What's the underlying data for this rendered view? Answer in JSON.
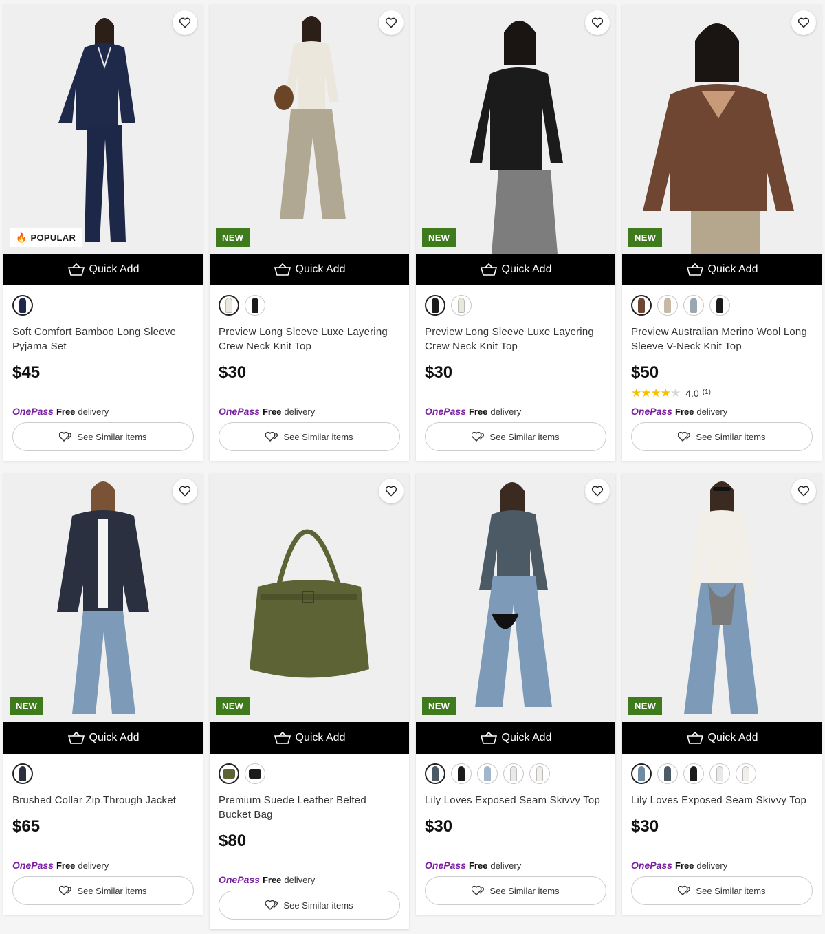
{
  "common": {
    "quick_add": "Quick Add",
    "see_similar": "See Similar items",
    "onepass_logo": "OnePass",
    "free": "Free",
    "delivery": "delivery",
    "badge_new": "NEW",
    "badge_popular": "POPULAR"
  },
  "products": [
    {
      "title": "Soft Comfort Bamboo Long Sleeve Pyjama Set",
      "price": "$45",
      "badge": "POPULAR",
      "swatches": [
        "#1f2a4a"
      ],
      "image": "navy-pyjama-set"
    },
    {
      "title": "Preview Long Sleeve Luxe Layering Crew Neck Knit Top",
      "price": "$30",
      "badge": "NEW",
      "swatches": [
        "#ece7dc",
        "#1b1b1b"
      ],
      "image": "cream-knit-top"
    },
    {
      "title": "Preview Long Sleeve Luxe Layering Crew Neck Knit Top",
      "price": "$30",
      "badge": "NEW",
      "swatches": [
        "#1b1b1b",
        "#ece7dc"
      ],
      "image": "black-knit-top"
    },
    {
      "title": "Preview Australian Merino Wool Long Sleeve V-Neck Knit Top",
      "price": "$50",
      "badge": "NEW",
      "swatches": [
        "#6e4632",
        "#c8b9a6",
        "#9aa7b0",
        "#1b1b1b"
      ],
      "image": "brown-vneck-knit",
      "rating": {
        "value": "4.0",
        "count": "(1)",
        "stars": 4
      }
    },
    {
      "title": "Brushed Collar Zip Through Jacket",
      "price": "$65",
      "badge": "NEW",
      "swatches": [
        "#2a3040"
      ],
      "image": "navy-zip-jacket"
    },
    {
      "title": "Premium Suede Leather Belted Bucket Bag",
      "price": "$80",
      "badge": "NEW",
      "swatches": [
        "#5d6334",
        "#1b1b1b"
      ],
      "image": "olive-suede-bag"
    },
    {
      "title": "Lily Loves Exposed Seam Skivvy Top",
      "price": "$30",
      "badge": "NEW",
      "swatches": [
        "#4c5a66",
        "#1b1b1b",
        "#9fb6cc",
        "#e9e9e9",
        "#f2efe8"
      ],
      "image": "grey-skivvy-top"
    },
    {
      "title": "Lily Loves Exposed Seam Skivvy Top",
      "price": "$30",
      "badge": "NEW",
      "swatches": [
        "#6f8aa3",
        "#4c5a66",
        "#1b1b1b",
        "#e9e9e9",
        "#f2efe8"
      ],
      "image": "white-skivvy-top"
    }
  ],
  "colors": {
    "new_badge": "#3f7a1d",
    "onepass": "#7b1fa2",
    "star": "#f5c000"
  }
}
